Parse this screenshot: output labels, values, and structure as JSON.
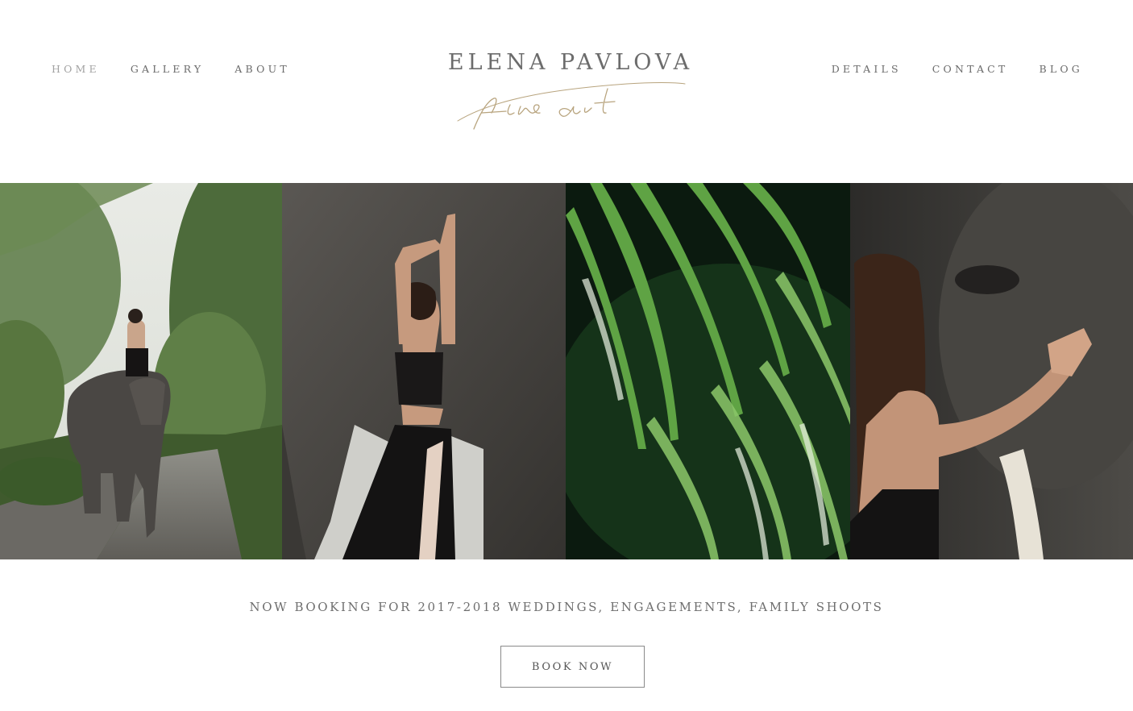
{
  "nav": {
    "left": [
      {
        "label": "HOME",
        "active": true
      },
      {
        "label": "GALLERY",
        "active": false
      },
      {
        "label": "ABOUT",
        "active": false
      }
    ],
    "right": [
      {
        "label": "DETAILS"
      },
      {
        "label": "CONTACT"
      },
      {
        "label": "BLOG"
      }
    ]
  },
  "logo": {
    "name": "ELENA PAVLOVA",
    "script": "fine art"
  },
  "gallery": {
    "images": [
      {
        "icon": "woman-riding-elephant-photo"
      },
      {
        "icon": "woman-leaning-on-elephant-photo"
      },
      {
        "icon": "palm-leaves-photo"
      },
      {
        "icon": "woman-touching-elephant-photo"
      }
    ]
  },
  "booking": {
    "text": "NOW BOOKING FOR 2017-2018 WEDDINGS, ENGAGEMENTS, FAMILY SHOOTS",
    "button_label": "BOOK NOW"
  },
  "colors": {
    "nav_text": "#6b6b6b",
    "nav_active": "#a2a2a2",
    "script_gold": "#b8a47e",
    "button_border": "#8a8a8a"
  }
}
